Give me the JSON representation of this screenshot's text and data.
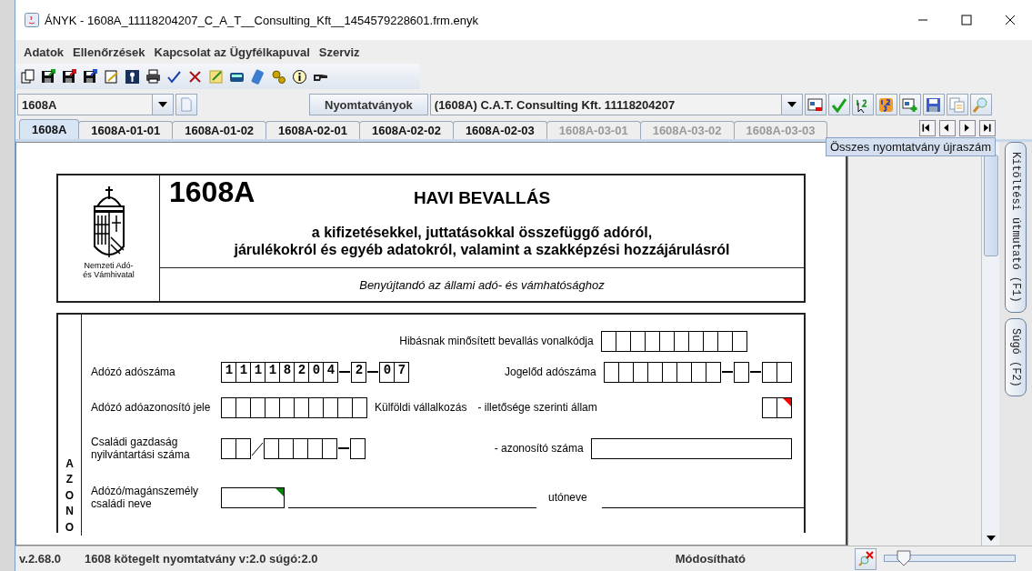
{
  "window": {
    "title": "ÁNYK - 1608A_11118204207_C_A_T__Consulting_Kft__1454579228601.frm.enyk"
  },
  "menu": [
    "Adatok",
    "Ellenőrzések",
    "Kapcsolat az Ügyfélkapuval",
    "Szerviz"
  ],
  "selector": {
    "form_value": "1608A",
    "forms_button": "Nyomtatványok",
    "document_value": "(1608A) C.A.T. Consulting Kft. 11118204207"
  },
  "tabs": [
    {
      "label": "1608A",
      "selected": true,
      "disabled": false
    },
    {
      "label": "1608A-01-01",
      "selected": false,
      "disabled": false
    },
    {
      "label": "1608A-01-02",
      "selected": false,
      "disabled": false
    },
    {
      "label": "1608A-02-01",
      "selected": false,
      "disabled": false
    },
    {
      "label": "1608A-02-02",
      "selected": false,
      "disabled": false
    },
    {
      "label": "1608A-02-03",
      "selected": false,
      "disabled": false
    },
    {
      "label": "1608A-03-01",
      "selected": false,
      "disabled": true
    },
    {
      "label": "1608A-03-02",
      "selected": false,
      "disabled": true
    },
    {
      "label": "1608A-03-03",
      "selected": false,
      "disabled": true
    }
  ],
  "tooltip": "Összes nyomtatvány újraszám",
  "side_tabs": [
    "Kitöltési útmutató (F1)",
    "Súgó (F2)"
  ],
  "form": {
    "authority": "Nemzeti Adó- és Vámhivatal",
    "code": "1608A",
    "title": "HAVI BEVALLÁS",
    "subtitle_lines": [
      "a kifizetésekkel, juttatásokkal összefüggő adóról,",
      "járulékokról és egyéb adatokról, valamint a szakképzési hozzájárulásról"
    ],
    "submit_note": "Benyújtandó az állami adó- és vámhatósághoz",
    "section_label": "AZONO",
    "rows": [
      {
        "right": [
          {
            "label": "Hibásnak minősített bevallás vonalkódja",
            "kind": "boxes"
          }
        ]
      },
      {
        "left": {
          "label": "Adózó adószáma",
          "kind": "boxes",
          "value_groups": [
            "11118204",
            "2",
            "07"
          ]
        },
        "right": [
          {
            "label": "Jogelőd adószáma",
            "kind": "boxes"
          }
        ]
      },
      {
        "left": {
          "label": "Adózó adóazonosító jele",
          "kind": "boxes"
        },
        "right": [
          {
            "label": "Külföldi vállalkozás",
            "kind": "caption"
          },
          {
            "label": "- illetősége szerinti állam",
            "kind": "boxes",
            "color": "#ff0000"
          }
        ]
      },
      {
        "left": {
          "label": "Családi gazdaság nyilvántartási száma",
          "kind": "boxes"
        },
        "right": [
          {
            "label": "- azonosító száma",
            "kind": "wide"
          }
        ]
      },
      {
        "left": {
          "label": "Adózó/magánszemély családi neve",
          "kind": "name",
          "color": "#008000"
        },
        "right": [
          {
            "label": "utóneve",
            "kind": "line"
          }
        ]
      }
    ]
  },
  "status_bar": {
    "version": "v.2.68.0",
    "package": "1608 kötegelt nyomtatvány v:2.0 súgó:2.0",
    "mode": "Módosítható",
    "zoom": {
      "level": 0.15
    }
  }
}
